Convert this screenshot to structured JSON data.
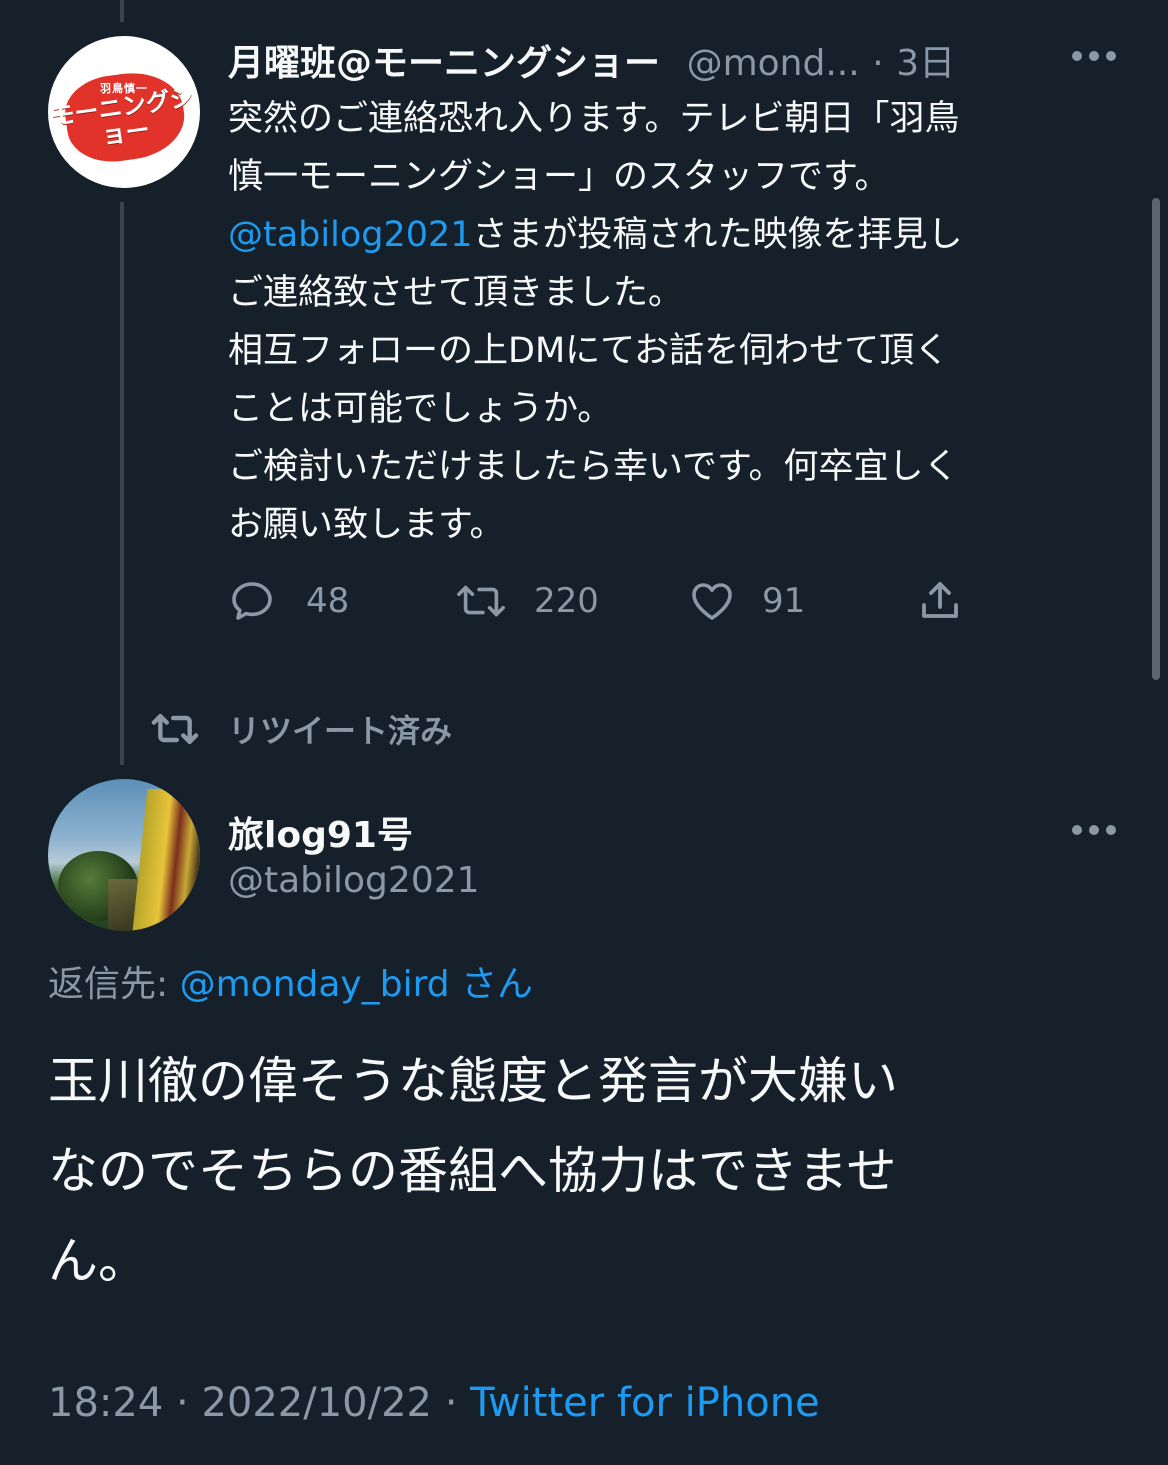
{
  "quoted_tweet": {
    "avatar": {
      "top_text": "羽鳥慎一",
      "main_text": "モーニングショー",
      "colors": {
        "blob": "#e2332b",
        "bg": "#ffffff"
      }
    },
    "display_name": "月曜班@モーニングショー",
    "handle": "@mond...",
    "separator": "·",
    "time": "3日",
    "text_lines": [
      "突然のご連絡恐れ入ります。テレビ朝日「羽鳥",
      "慎一モーニングショー」のスタッフです。",
      "さまが投稿された映像を拝見し",
      "ご連絡致させて頂きました。",
      "相互フォローの上DMにてお話を伺わせて頂く",
      "ことは可能でしょうか。",
      "ご検討いただけましたら幸いです。何卒宜しく",
      "お願い致します。"
    ],
    "mention": "@tabilog2021",
    "actions": {
      "reply": {
        "icon": "reply-icon",
        "count": "48"
      },
      "retweet": {
        "icon": "retweet-icon",
        "count": "220"
      },
      "like": {
        "icon": "heart-icon",
        "count": "91"
      },
      "share": {
        "icon": "share-icon"
      }
    }
  },
  "retweeted_label": "リツイート済み",
  "main_tweet": {
    "display_name": "旅log91号",
    "handle": "@tabilog2021",
    "reply_prefix": "返信先:",
    "reply_mention": "@monday_bird",
    "reply_suffix": "さん",
    "text_lines": [
      "玉川徹の偉そうな態度と発言が大嫌い",
      "なのでそちらの番組へ協力はできませ",
      "ん。"
    ],
    "time": "18:24",
    "separator": "·",
    "date": "2022/10/22",
    "source": "Twitter for iPhone"
  },
  "colors": {
    "background": "#15202b",
    "text": "#f7f9f9",
    "secondary": "#8b98a5",
    "link": "#1d9bf0"
  }
}
